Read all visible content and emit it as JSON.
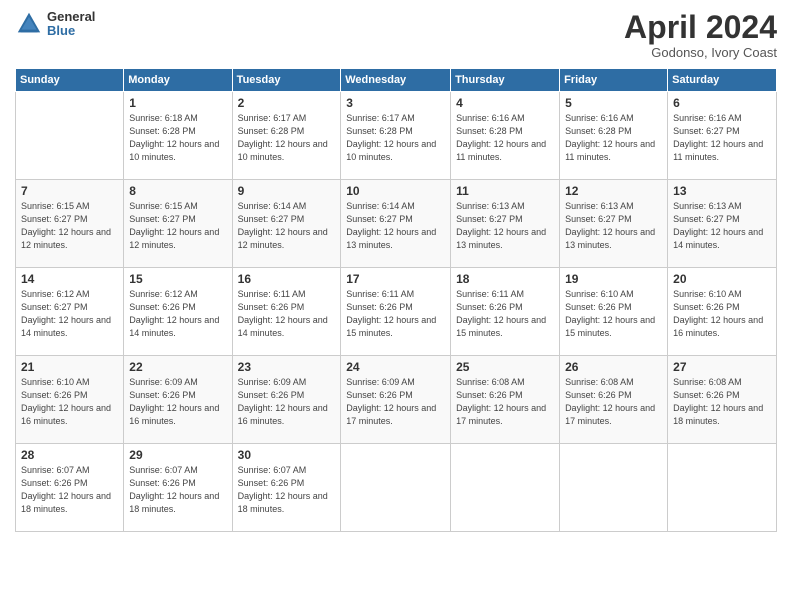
{
  "header": {
    "logo_general": "General",
    "logo_blue": "Blue",
    "month_title": "April 2024",
    "subtitle": "Godonso, Ivory Coast"
  },
  "days_of_week": [
    "Sunday",
    "Monday",
    "Tuesday",
    "Wednesday",
    "Thursday",
    "Friday",
    "Saturday"
  ],
  "weeks": [
    [
      {
        "day": "",
        "sunrise": "",
        "sunset": "",
        "daylight": ""
      },
      {
        "day": "1",
        "sunrise": "Sunrise: 6:18 AM",
        "sunset": "Sunset: 6:28 PM",
        "daylight": "Daylight: 12 hours and 10 minutes."
      },
      {
        "day": "2",
        "sunrise": "Sunrise: 6:17 AM",
        "sunset": "Sunset: 6:28 PM",
        "daylight": "Daylight: 12 hours and 10 minutes."
      },
      {
        "day": "3",
        "sunrise": "Sunrise: 6:17 AM",
        "sunset": "Sunset: 6:28 PM",
        "daylight": "Daylight: 12 hours and 10 minutes."
      },
      {
        "day": "4",
        "sunrise": "Sunrise: 6:16 AM",
        "sunset": "Sunset: 6:28 PM",
        "daylight": "Daylight: 12 hours and 11 minutes."
      },
      {
        "day": "5",
        "sunrise": "Sunrise: 6:16 AM",
        "sunset": "Sunset: 6:28 PM",
        "daylight": "Daylight: 12 hours and 11 minutes."
      },
      {
        "day": "6",
        "sunrise": "Sunrise: 6:16 AM",
        "sunset": "Sunset: 6:27 PM",
        "daylight": "Daylight: 12 hours and 11 minutes."
      }
    ],
    [
      {
        "day": "7",
        "sunrise": "Sunrise: 6:15 AM",
        "sunset": "Sunset: 6:27 PM",
        "daylight": "Daylight: 12 hours and 12 minutes."
      },
      {
        "day": "8",
        "sunrise": "Sunrise: 6:15 AM",
        "sunset": "Sunset: 6:27 PM",
        "daylight": "Daylight: 12 hours and 12 minutes."
      },
      {
        "day": "9",
        "sunrise": "Sunrise: 6:14 AM",
        "sunset": "Sunset: 6:27 PM",
        "daylight": "Daylight: 12 hours and 12 minutes."
      },
      {
        "day": "10",
        "sunrise": "Sunrise: 6:14 AM",
        "sunset": "Sunset: 6:27 PM",
        "daylight": "Daylight: 12 hours and 13 minutes."
      },
      {
        "day": "11",
        "sunrise": "Sunrise: 6:13 AM",
        "sunset": "Sunset: 6:27 PM",
        "daylight": "Daylight: 12 hours and 13 minutes."
      },
      {
        "day": "12",
        "sunrise": "Sunrise: 6:13 AM",
        "sunset": "Sunset: 6:27 PM",
        "daylight": "Daylight: 12 hours and 13 minutes."
      },
      {
        "day": "13",
        "sunrise": "Sunrise: 6:13 AM",
        "sunset": "Sunset: 6:27 PM",
        "daylight": "Daylight: 12 hours and 14 minutes."
      }
    ],
    [
      {
        "day": "14",
        "sunrise": "Sunrise: 6:12 AM",
        "sunset": "Sunset: 6:27 PM",
        "daylight": "Daylight: 12 hours and 14 minutes."
      },
      {
        "day": "15",
        "sunrise": "Sunrise: 6:12 AM",
        "sunset": "Sunset: 6:26 PM",
        "daylight": "Daylight: 12 hours and 14 minutes."
      },
      {
        "day": "16",
        "sunrise": "Sunrise: 6:11 AM",
        "sunset": "Sunset: 6:26 PM",
        "daylight": "Daylight: 12 hours and 14 minutes."
      },
      {
        "day": "17",
        "sunrise": "Sunrise: 6:11 AM",
        "sunset": "Sunset: 6:26 PM",
        "daylight": "Daylight: 12 hours and 15 minutes."
      },
      {
        "day": "18",
        "sunrise": "Sunrise: 6:11 AM",
        "sunset": "Sunset: 6:26 PM",
        "daylight": "Daylight: 12 hours and 15 minutes."
      },
      {
        "day": "19",
        "sunrise": "Sunrise: 6:10 AM",
        "sunset": "Sunset: 6:26 PM",
        "daylight": "Daylight: 12 hours and 15 minutes."
      },
      {
        "day": "20",
        "sunrise": "Sunrise: 6:10 AM",
        "sunset": "Sunset: 6:26 PM",
        "daylight": "Daylight: 12 hours and 16 minutes."
      }
    ],
    [
      {
        "day": "21",
        "sunrise": "Sunrise: 6:10 AM",
        "sunset": "Sunset: 6:26 PM",
        "daylight": "Daylight: 12 hours and 16 minutes."
      },
      {
        "day": "22",
        "sunrise": "Sunrise: 6:09 AM",
        "sunset": "Sunset: 6:26 PM",
        "daylight": "Daylight: 12 hours and 16 minutes."
      },
      {
        "day": "23",
        "sunrise": "Sunrise: 6:09 AM",
        "sunset": "Sunset: 6:26 PM",
        "daylight": "Daylight: 12 hours and 16 minutes."
      },
      {
        "day": "24",
        "sunrise": "Sunrise: 6:09 AM",
        "sunset": "Sunset: 6:26 PM",
        "daylight": "Daylight: 12 hours and 17 minutes."
      },
      {
        "day": "25",
        "sunrise": "Sunrise: 6:08 AM",
        "sunset": "Sunset: 6:26 PM",
        "daylight": "Daylight: 12 hours and 17 minutes."
      },
      {
        "day": "26",
        "sunrise": "Sunrise: 6:08 AM",
        "sunset": "Sunset: 6:26 PM",
        "daylight": "Daylight: 12 hours and 17 minutes."
      },
      {
        "day": "27",
        "sunrise": "Sunrise: 6:08 AM",
        "sunset": "Sunset: 6:26 PM",
        "daylight": "Daylight: 12 hours and 18 minutes."
      }
    ],
    [
      {
        "day": "28",
        "sunrise": "Sunrise: 6:07 AM",
        "sunset": "Sunset: 6:26 PM",
        "daylight": "Daylight: 12 hours and 18 minutes."
      },
      {
        "day": "29",
        "sunrise": "Sunrise: 6:07 AM",
        "sunset": "Sunset: 6:26 PM",
        "daylight": "Daylight: 12 hours and 18 minutes."
      },
      {
        "day": "30",
        "sunrise": "Sunrise: 6:07 AM",
        "sunset": "Sunset: 6:26 PM",
        "daylight": "Daylight: 12 hours and 18 minutes."
      },
      {
        "day": "",
        "sunrise": "",
        "sunset": "",
        "daylight": ""
      },
      {
        "day": "",
        "sunrise": "",
        "sunset": "",
        "daylight": ""
      },
      {
        "day": "",
        "sunrise": "",
        "sunset": "",
        "daylight": ""
      },
      {
        "day": "",
        "sunrise": "",
        "sunset": "",
        "daylight": ""
      }
    ]
  ]
}
